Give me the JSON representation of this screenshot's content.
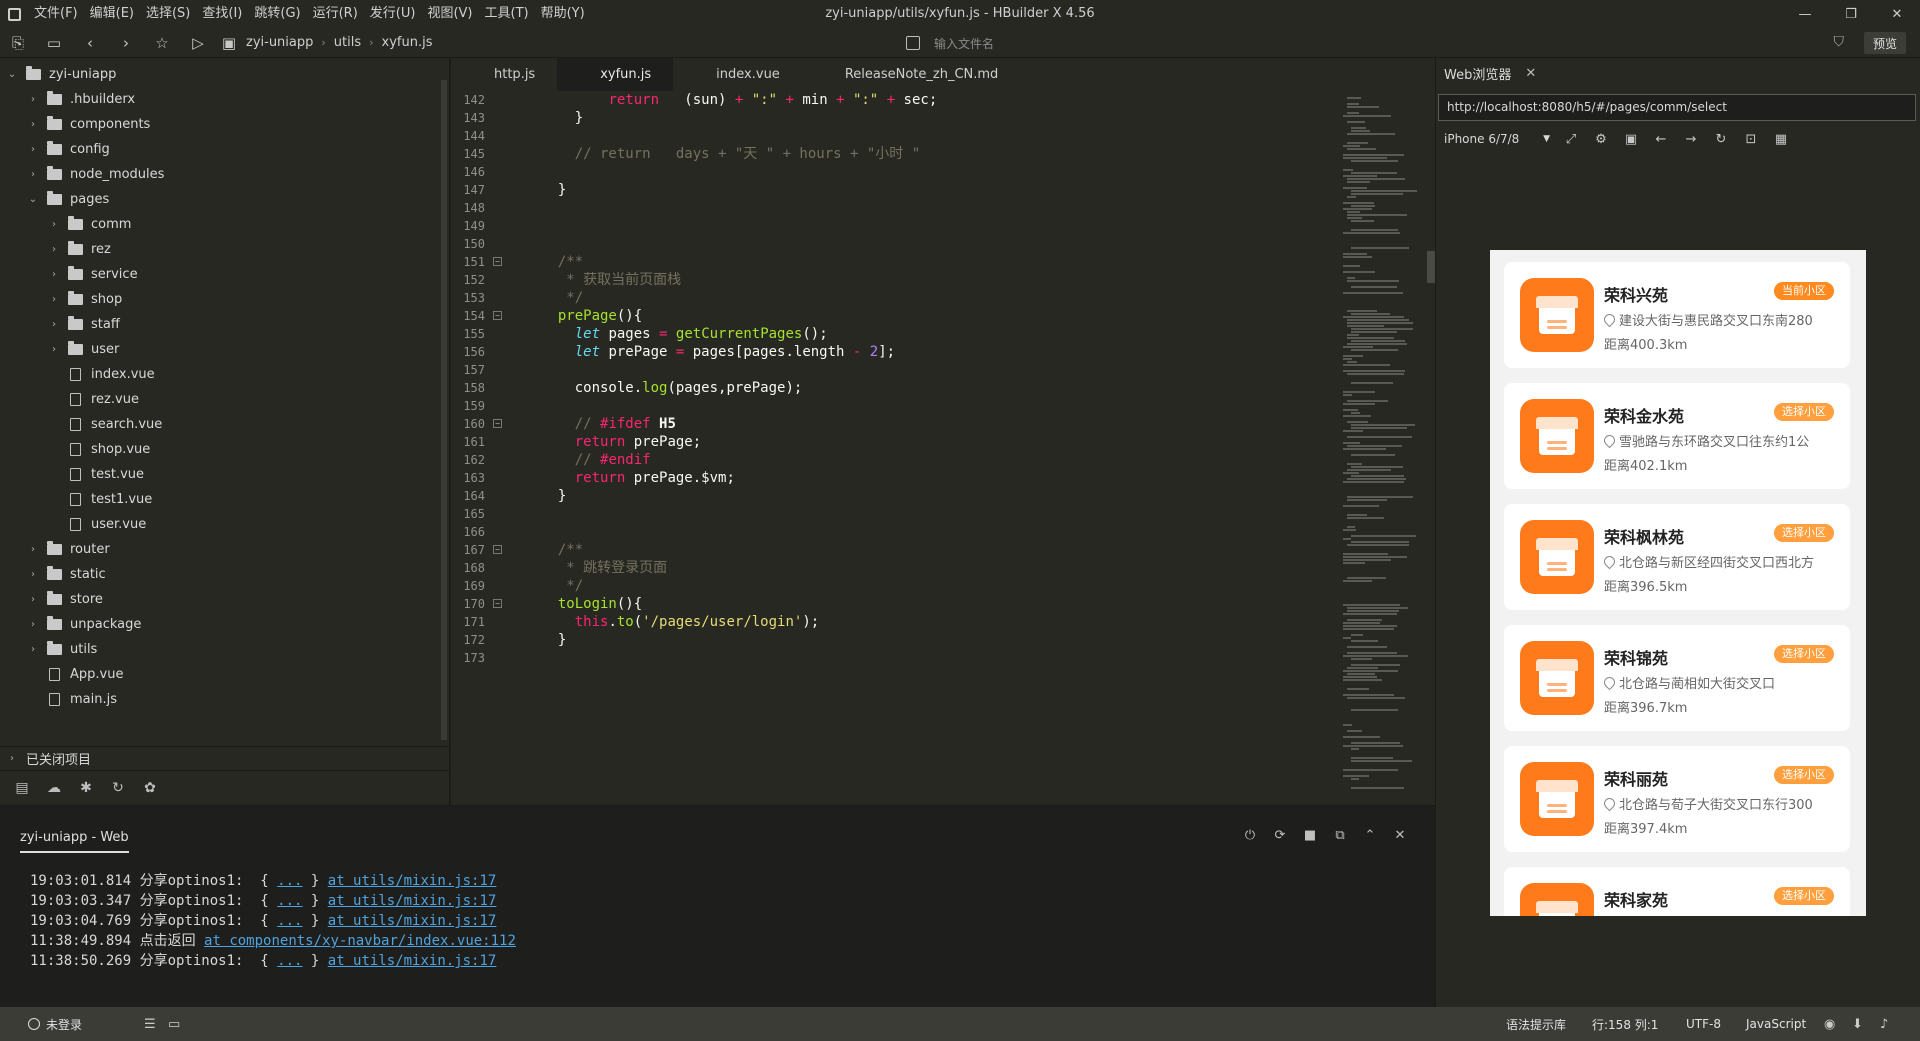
{
  "window": {
    "title": "zyi-uniapp/utils/xyfun.js - HBuilder X 4.56",
    "controls": [
      "—",
      "❐",
      "✕"
    ]
  },
  "menu": [
    "文件(F)",
    "编辑(E)",
    "选择(S)",
    "查找(I)",
    "跳转(G)",
    "运行(R)",
    "发行(U)",
    "视图(V)",
    "工具(T)",
    "帮助(Y)"
  ],
  "toolbar": {
    "breadcrumb": [
      "zyi-uniapp",
      "utils",
      "xyfun.js"
    ],
    "file_search_placeholder": "输入文件名",
    "preview_label": "预览"
  },
  "tree": {
    "items": [
      {
        "label": "zyi-uniapp",
        "type": "folder",
        "depth": 0,
        "open": true
      },
      {
        "label": ".hbuilderx",
        "type": "folder",
        "depth": 1,
        "open": false
      },
      {
        "label": "components",
        "type": "folder",
        "depth": 1,
        "open": false
      },
      {
        "label": "config",
        "type": "folder",
        "depth": 1,
        "open": false
      },
      {
        "label": "node_modules",
        "type": "folder",
        "depth": 1,
        "open": false
      },
      {
        "label": "pages",
        "type": "folder",
        "depth": 1,
        "open": true
      },
      {
        "label": "comm",
        "type": "folder",
        "depth": 2,
        "open": false
      },
      {
        "label": "rez",
        "type": "folder",
        "depth": 2,
        "open": false
      },
      {
        "label": "service",
        "type": "folder",
        "depth": 2,
        "open": false
      },
      {
        "label": "shop",
        "type": "folder",
        "depth": 2,
        "open": false
      },
      {
        "label": "staff",
        "type": "folder",
        "depth": 2,
        "open": false
      },
      {
        "label": "user",
        "type": "folder",
        "depth": 2,
        "open": false
      },
      {
        "label": "index.vue",
        "type": "file",
        "depth": 2
      },
      {
        "label": "rez.vue",
        "type": "file",
        "depth": 2
      },
      {
        "label": "search.vue",
        "type": "file",
        "depth": 2
      },
      {
        "label": "shop.vue",
        "type": "file",
        "depth": 2
      },
      {
        "label": "test.vue",
        "type": "file",
        "depth": 2
      },
      {
        "label": "test1.vue",
        "type": "file",
        "depth": 2
      },
      {
        "label": "user.vue",
        "type": "file",
        "depth": 2
      },
      {
        "label": "router",
        "type": "folder",
        "depth": 1,
        "open": false
      },
      {
        "label": "static",
        "type": "folder",
        "depth": 1,
        "open": false
      },
      {
        "label": "store",
        "type": "folder",
        "depth": 1,
        "open": false
      },
      {
        "label": "unpackage",
        "type": "folder",
        "depth": 1,
        "open": false
      },
      {
        "label": "utils",
        "type": "folder",
        "depth": 1,
        "open": false
      },
      {
        "label": "App.vue",
        "type": "file",
        "depth": 1
      },
      {
        "label": "main.js",
        "type": "file",
        "depth": 1
      }
    ],
    "closed_projects_label": "已关闭项目"
  },
  "editor": {
    "tabs": [
      {
        "label": "http.js",
        "active": false
      },
      {
        "label": "xyfun.js",
        "active": true
      },
      {
        "label": "index.vue",
        "active": false
      },
      {
        "label": "ReleaseNote_zh_CN.md",
        "active": false
      }
    ],
    "lines": [
      {
        "n": "142",
        "fold": false,
        "html": "        <span class=\"kw\">return</span>   (sun) <span class=\"kw\">+</span> <span class=\"str\">\":\"</span> <span class=\"kw\">+</span> min <span class=\"kw\">+</span> <span class=\"str\">\":\"</span> <span class=\"kw\">+</span> sec;"
      },
      {
        "n": "143",
        "fold": false,
        "html": "    }"
      },
      {
        "n": "144",
        "fold": false,
        "html": ""
      },
      {
        "n": "145",
        "fold": false,
        "html": "    <span class=\"cm\">// return   days + \"天 \" + hours + \"小时 \"</span>"
      },
      {
        "n": "146",
        "fold": false,
        "html": ""
      },
      {
        "n": "147",
        "fold": false,
        "html": "  }"
      },
      {
        "n": "148",
        "fold": false,
        "html": ""
      },
      {
        "n": "149",
        "fold": false,
        "html": ""
      },
      {
        "n": "150",
        "fold": false,
        "html": ""
      },
      {
        "n": "151",
        "fold": true,
        "html": "  <span class=\"cm\">/**</span>"
      },
      {
        "n": "152",
        "fold": false,
        "html": "  <span class=\"cm\"> * 获取当前页面栈</span>"
      },
      {
        "n": "153",
        "fold": false,
        "html": "  <span class=\"cm\"> */</span>"
      },
      {
        "n": "154",
        "fold": true,
        "html": "  <span class=\"fn\">prePage</span>(){"
      },
      {
        "n": "155",
        "fold": false,
        "html": "    <span class=\"var\">let</span> pages <span class=\"kw\">=</span> <span class=\"fn\">getCurrentPages</span>();"
      },
      {
        "n": "156",
        "fold": false,
        "html": "    <span class=\"var\">let</span> prePage <span class=\"kw\">=</span> pages[pages.length <span class=\"kw\">-</span> <span class=\"num\">2</span>];"
      },
      {
        "n": "157",
        "fold": false,
        "html": ""
      },
      {
        "n": "158",
        "fold": false,
        "html": "    console.<span class=\"fn\">log</span>(pages,prePage);"
      },
      {
        "n": "159",
        "fold": false,
        "html": ""
      },
      {
        "n": "160",
        "fold": true,
        "html": "    <span class=\"cm\">// </span><span class=\"kw\">#ifdef</span> <span class=\"bold\">H5</span>"
      },
      {
        "n": "161",
        "fold": false,
        "html": "    <span class=\"kw\">return</span> prePage;"
      },
      {
        "n": "162",
        "fold": false,
        "html": "    <span class=\"cm\">// </span><span class=\"kw\">#endif</span>"
      },
      {
        "n": "163",
        "fold": false,
        "html": "    <span class=\"kw\">return</span> prePage.$vm;"
      },
      {
        "n": "164",
        "fold": false,
        "html": "  }"
      },
      {
        "n": "165",
        "fold": false,
        "html": ""
      },
      {
        "n": "166",
        "fold": false,
        "html": ""
      },
      {
        "n": "167",
        "fold": true,
        "html": "  <span class=\"cm\">/**</span>"
      },
      {
        "n": "168",
        "fold": false,
        "html": "  <span class=\"cm\"> * 跳转登录页面</span>"
      },
      {
        "n": "169",
        "fold": false,
        "html": "  <span class=\"cm\"> */</span>"
      },
      {
        "n": "170",
        "fold": true,
        "html": "  <span class=\"fn\">toLogin</span>(){"
      },
      {
        "n": "171",
        "fold": false,
        "html": "    <span class=\"kw\">this</span>.<span class=\"fn\">to</span>(<span class=\"str\">'/pages/user/login'</span>);"
      },
      {
        "n": "172",
        "fold": false,
        "html": "  }"
      },
      {
        "n": "173",
        "fold": false,
        "html": ""
      }
    ]
  },
  "console": {
    "tab_label": "zyi-uniapp - Web",
    "logs": [
      {
        "time": "19:03:01.814",
        "msg": "分享optinos1:  { ",
        "ellipsis": "...",
        "tail": " } ",
        "link": "at utils/mixin.js:17"
      },
      {
        "time": "19:03:03.347",
        "msg": "分享optinos1:  { ",
        "ellipsis": "...",
        "tail": " } ",
        "link": "at utils/mixin.js:17"
      },
      {
        "time": "19:03:04.769",
        "msg": "分享optinos1:  { ",
        "ellipsis": "...",
        "tail": " } ",
        "link": "at utils/mixin.js:17"
      },
      {
        "time": "11:38:49.894",
        "msg": "点击返回 ",
        "ellipsis": "",
        "tail": "",
        "link": "at components/xy-navbar/index.vue:112"
      },
      {
        "time": "11:38:50.269",
        "msg": "分享optinos1:  { ",
        "ellipsis": "...",
        "tail": " } ",
        "link": "at utils/mixin.js:17"
      }
    ]
  },
  "browser": {
    "tab_label": "Web浏览器",
    "url": "http://localhost:8080/h5/#/pages/comm/select",
    "device": "iPhone 6/7/8",
    "cards": [
      {
        "name": "荣科兴苑",
        "badge": "当前小区",
        "current": true,
        "address": "建设大街与惠民路交叉口东南280",
        "distance": "距离400.3km"
      },
      {
        "name": "荣科金水苑",
        "badge": "选择小区",
        "current": false,
        "address": "雪驰路与东环路交叉口往东约1公",
        "distance": "距离402.1km"
      },
      {
        "name": "荣科枫林苑",
        "badge": "选择小区",
        "current": false,
        "address": "北仓路与新区经四街交叉口西北方",
        "distance": "距离396.5km"
      },
      {
        "name": "荣科锦苑",
        "badge": "选择小区",
        "current": false,
        "address": "北仓路与蔺相如大街交叉口",
        "distance": "距离396.7km"
      },
      {
        "name": "荣科丽苑",
        "badge": "选择小区",
        "current": false,
        "address": "北仓路与荀子大街交叉口东行300",
        "distance": "距离397.4km"
      },
      {
        "name": "荣科家苑",
        "badge": "选择小区",
        "current": false,
        "address": "",
        "distance": ""
      }
    ]
  },
  "statusbar": {
    "user": "未登录",
    "syntax_lib": "语法提示库",
    "position": "行:158  列:1",
    "encoding": "UTF-8",
    "language": "JavaScript"
  }
}
